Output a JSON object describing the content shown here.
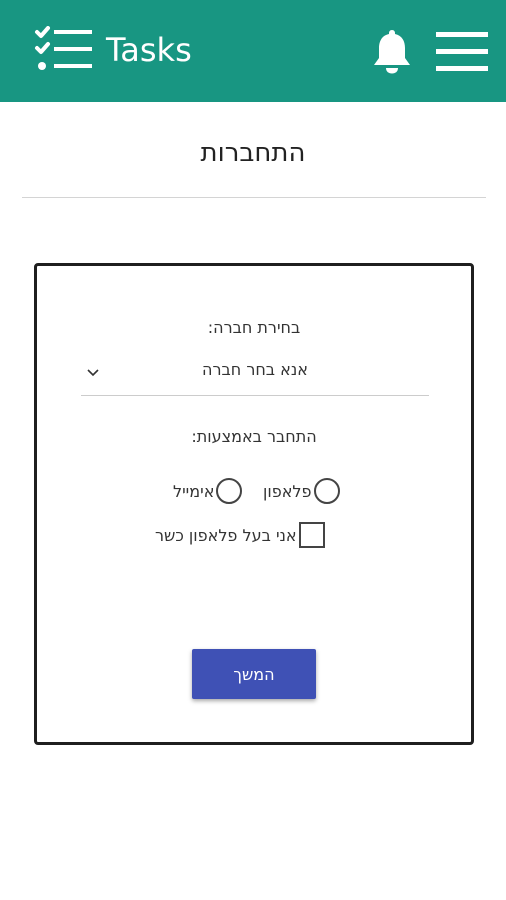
{
  "app": {
    "title": "Tasks",
    "header_color": "#189682",
    "logo_icon": "checklist-icon",
    "notification_icon": "bell-icon",
    "menu_icon": "hamburger-menu-icon"
  },
  "page": {
    "title": "התחברות"
  },
  "form": {
    "company_label": "בחירת חברה:",
    "company_select_value": "אנא בחר חברה",
    "connect_label": "התחבר באמצעות:",
    "radio_options": [
      {
        "label": "פלאפון",
        "selected": false
      },
      {
        "label": "אימייל",
        "selected": false
      }
    ],
    "kosher_phone_label": "אני בעל פלאפון כשר",
    "kosher_phone_checked": false,
    "continue_label": "המשך",
    "button_color": "#3f51b5"
  }
}
